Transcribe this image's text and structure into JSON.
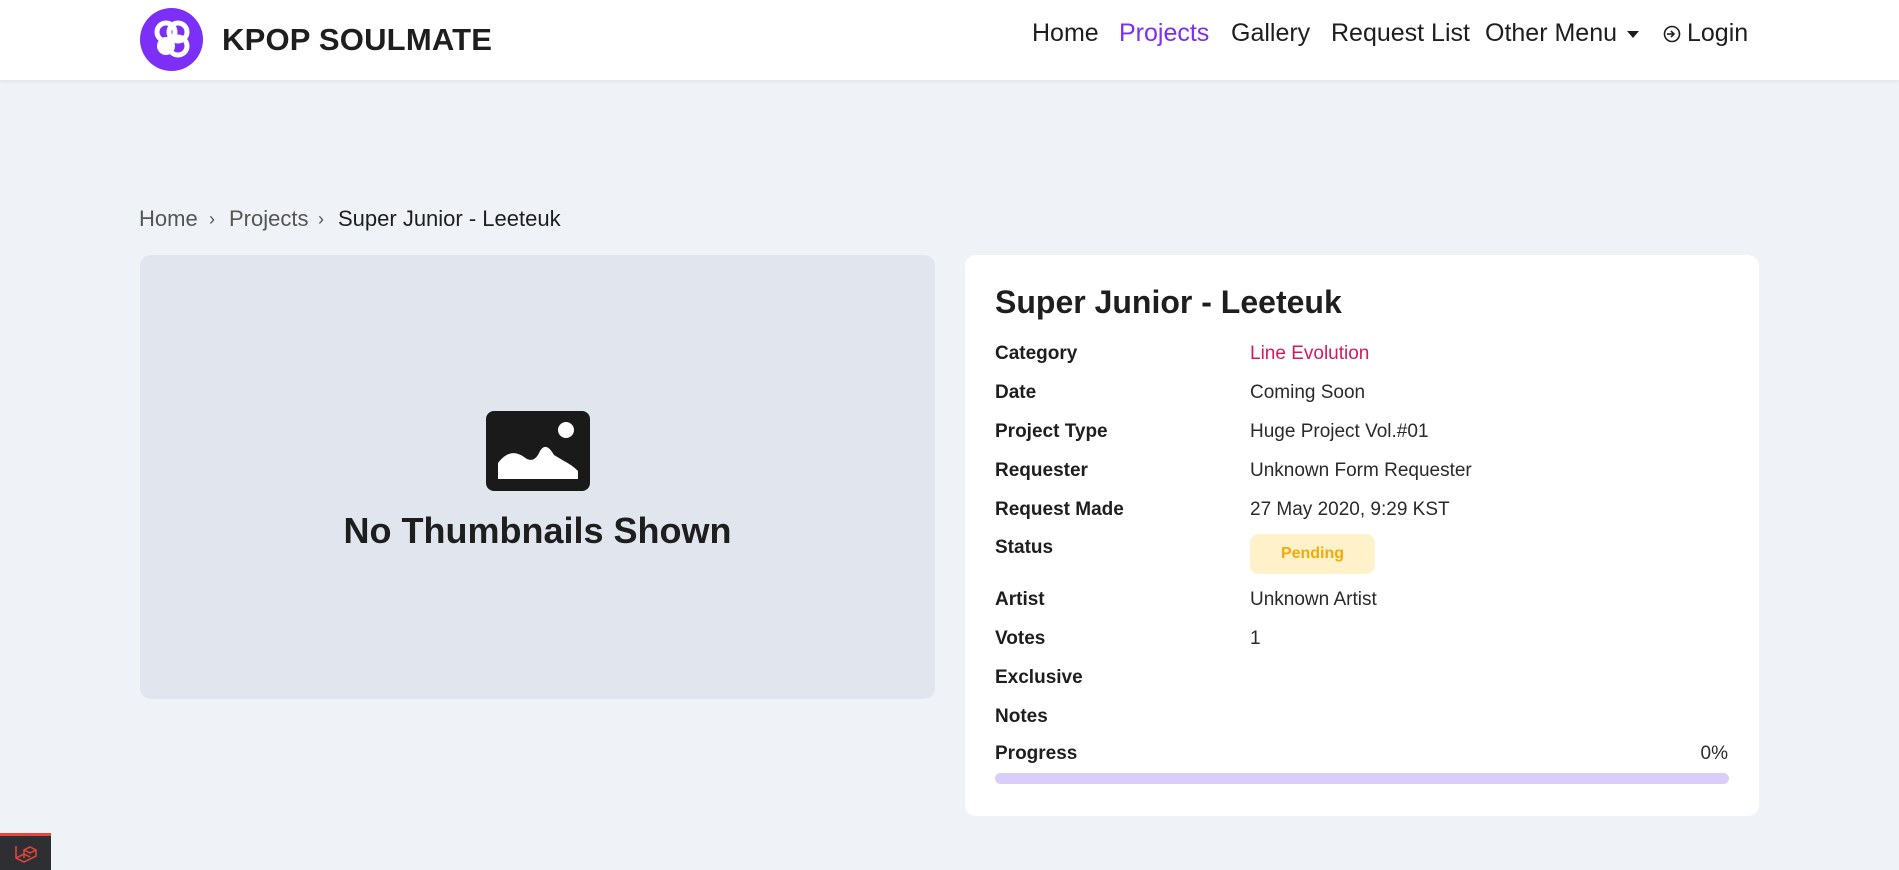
{
  "header": {
    "brand_name": "KPOP SOULMATE",
    "brand_color": "#7b2ff7",
    "nav": [
      {
        "label": "Home",
        "active": false
      },
      {
        "label": "Projects",
        "active": true
      },
      {
        "label": "Gallery",
        "active": false
      },
      {
        "label": "Request List",
        "active": false
      },
      {
        "label": "Other Menu",
        "active": false
      },
      {
        "label": "Login",
        "active": false
      }
    ]
  },
  "breadcrumb": {
    "items": [
      "Home",
      "Projects",
      "Super Junior - Leeteuk"
    ],
    "separator": "›"
  },
  "thumbnail": {
    "icon": "image-icon",
    "text": "No Thumbnails Shown"
  },
  "project": {
    "title": "Super Junior - Leeteuk",
    "rows": {
      "category": {
        "label": "Category",
        "value": "Line Evolution"
      },
      "date": {
        "label": "Date",
        "value": "Coming Soon"
      },
      "project_type": {
        "label": "Project Type",
        "value": "Huge Project Vol.#01"
      },
      "requester": {
        "label": "Requester",
        "value": "Unknown Form Requester"
      },
      "request_made": {
        "label": "Request Made",
        "value": "27 May 2020, 9:29 KST"
      },
      "status": {
        "label": "Status",
        "value": "Pending"
      },
      "artist": {
        "label": "Artist",
        "value": "Unknown Artist"
      },
      "votes": {
        "label": "Votes",
        "value": "1"
      },
      "exclusive": {
        "label": "Exclusive",
        "value": ""
      },
      "notes": {
        "label": "Notes",
        "value": ""
      }
    },
    "progress": {
      "label": "Progress",
      "percent_text": "0%",
      "value": 0
    },
    "category_color": "#d6195e",
    "status_color": "#f2ab0b"
  }
}
